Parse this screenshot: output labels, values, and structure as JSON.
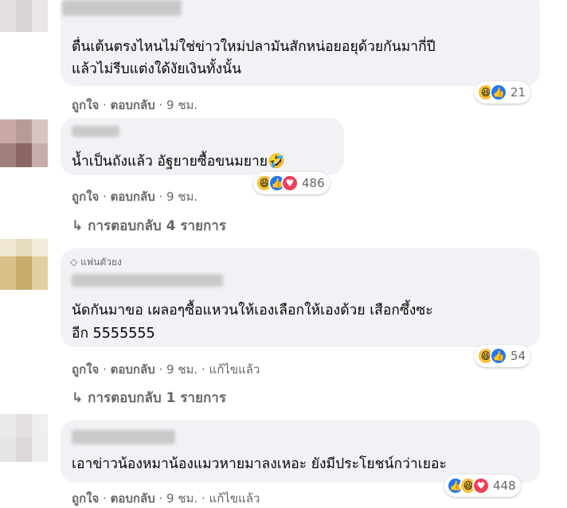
{
  "comments": [
    {
      "text_lines": [
        "ตื่นเต้นตรงไหนไม่ใช่ข่าวใหม่ปลามันสักหน่อยอยุด้วยกันมากี่ปี",
        "แล้วไม่รีบแต่งใด้งัยเงินทั้งนั้น"
      ],
      "reactions": [
        "haha",
        "like"
      ],
      "reaction_count": "21",
      "like": "ถูกใจ",
      "reply": "ตอบกลับ",
      "time": "9 ชม.",
      "edited": ""
    },
    {
      "text_lines": [
        "น้ำเป็นถังแล้ว อัฐยายซื้อขนมยาย🤣"
      ],
      "reactions": [
        "haha",
        "like",
        "love"
      ],
      "reaction_count": "486",
      "like": "ถูกใจ",
      "reply": "ตอบกลับ",
      "time": "9 ชม.",
      "edited": "",
      "replies_label": "การตอบกลับ 4 รายการ"
    },
    {
      "badge": "แฟนตัวยง",
      "text_lines": [
        "นัดกันมาขอ เผลอๆซื้อแหวนให้เองเลือกให้เองด้วย เสือกซึ้งซะ",
        "อีก 5555555"
      ],
      "reactions": [
        "haha",
        "like"
      ],
      "reaction_count": "54",
      "like": "ถูกใจ",
      "reply": "ตอบกลับ",
      "time": "9 ชม.",
      "edited": "แก้ไขแล้ว",
      "replies_label": "การตอบกลับ 1 รายการ"
    },
    {
      "text_lines": [
        "เอาข่าวน้องหมาน้องแมวหายมาลงเหอะ ยังมีประโยชน์กว่าเยอะ"
      ],
      "reactions": [
        "like",
        "haha",
        "love"
      ],
      "reaction_count": "448",
      "like": "ถูกใจ",
      "reply": "ตอบกลับ",
      "time": "9 ชม.",
      "edited": "แก้ไขแล้ว"
    }
  ],
  "separator": "·",
  "reply_arrow": "↳",
  "colors": {
    "bubble": "#f0f2f5",
    "meta": "#65676b",
    "like": "#2078f4",
    "haha": "#f7c33a",
    "love": "#f33e58"
  }
}
